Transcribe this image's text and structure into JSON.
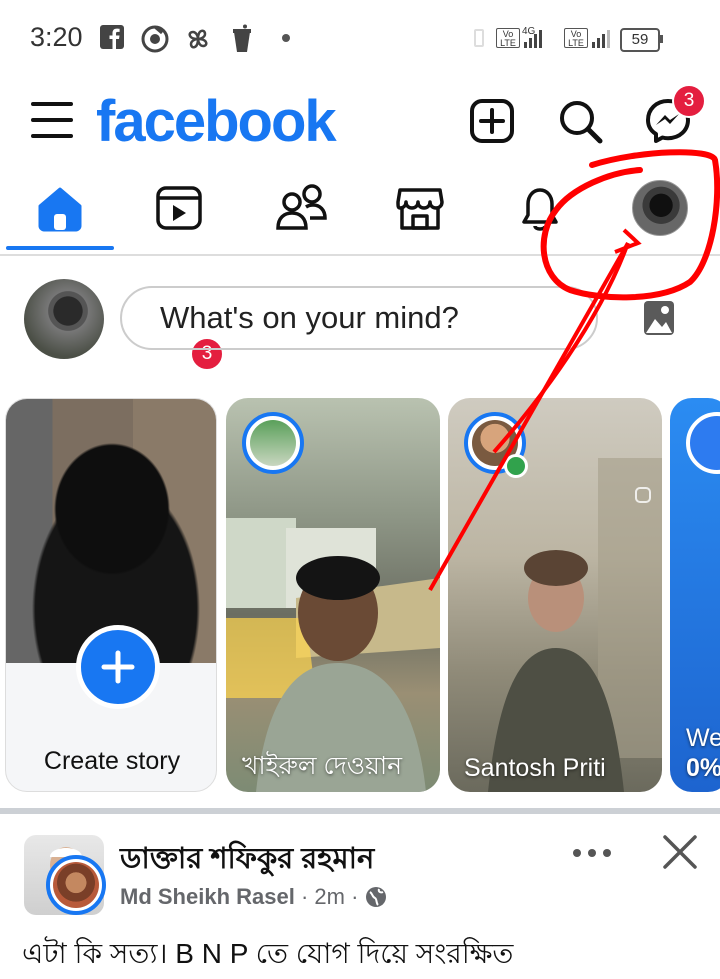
{
  "status_bar": {
    "time": "3:20",
    "icons": [
      "facebook-icon",
      "chrome-like-icon",
      "pinwheel-icon",
      "cup-icon",
      "dot-icon"
    ],
    "network_1": "Vo LTE",
    "network_type": "4G",
    "network_2": "Vo LTE",
    "battery": "59"
  },
  "header": {
    "brand": "facebook",
    "messenger_badge": "3"
  },
  "tabs": [
    {
      "name": "home",
      "active": true
    },
    {
      "name": "video",
      "badge": "3"
    },
    {
      "name": "friends"
    },
    {
      "name": "marketplace"
    },
    {
      "name": "notifications"
    },
    {
      "name": "profile"
    }
  ],
  "composer": {
    "placeholder": "What's on your mind?"
  },
  "stories": [
    {
      "label": "Create story"
    },
    {
      "name": "খাইরুল দেওয়ান"
    },
    {
      "name": "Santosh Priti"
    },
    {
      "name": "We",
      "sub": "0%"
    }
  ],
  "post": {
    "author": "ডাক্তার শফিকুর রহমান",
    "poster": "Md Sheikh Rasel",
    "time": "2m",
    "separator": "·",
    "text": "এটা কি সত্য। B N P তে যোগ দিয়ে সংরক্ষিত"
  },
  "colors": {
    "brand": "#1877f2",
    "badge": "#e41e3f",
    "annotation": "#ff0000"
  }
}
